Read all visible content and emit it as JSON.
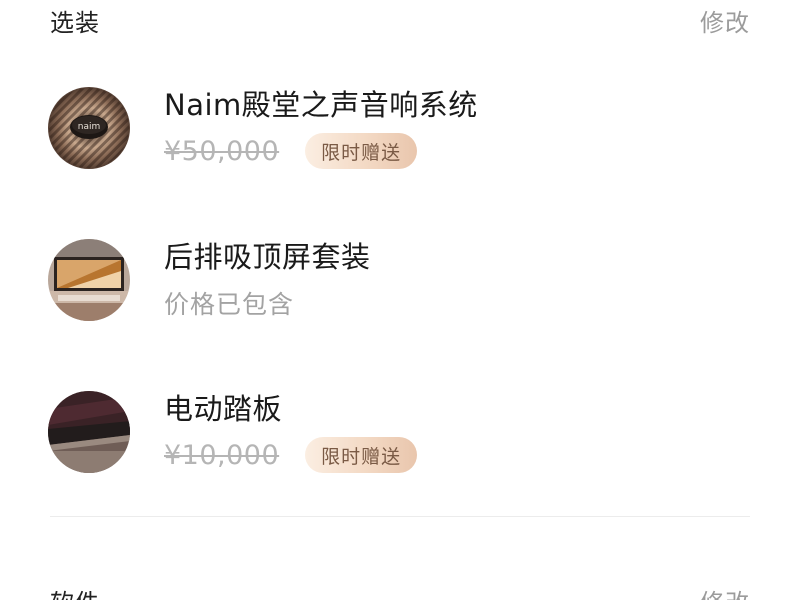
{
  "options_section": {
    "title": "选装",
    "edit_label": "修改",
    "items": [
      {
        "name": "Naim殿堂之声音响系统",
        "price": "¥50,000",
        "badge": "限时赠送",
        "thumb_icon": "speaker-grille-thumbnail"
      },
      {
        "name": "后排吸顶屏套装",
        "note": "价格已包含",
        "thumb_icon": "ceiling-screen-thumbnail"
      },
      {
        "name": "电动踏板",
        "price": "¥10,000",
        "badge": "限时赠送",
        "thumb_icon": "running-board-thumbnail"
      }
    ]
  },
  "software_section": {
    "title": "软件",
    "edit_label": "修改"
  },
  "colors": {
    "badge_text": "#7a5a45",
    "badge_bg_start": "#fbeee2",
    "badge_bg_end": "#e9c6ad",
    "muted_text": "#9b9b9b"
  }
}
